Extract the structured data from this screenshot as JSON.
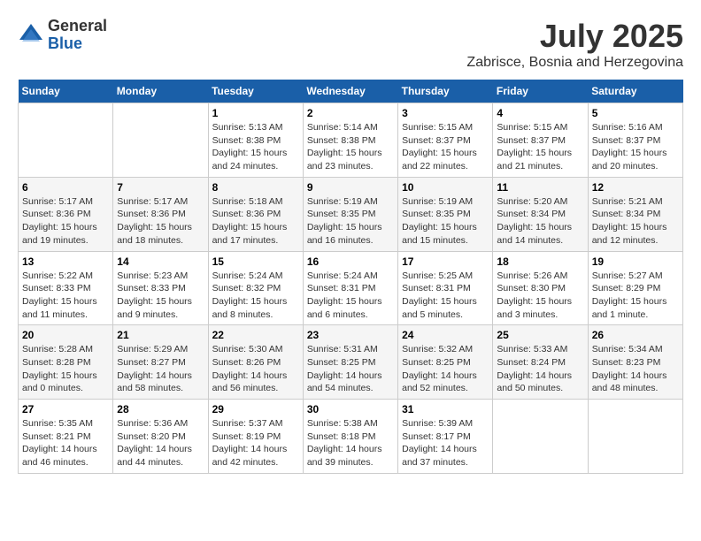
{
  "logo": {
    "general": "General",
    "blue": "Blue"
  },
  "header": {
    "month": "July 2025",
    "location": "Zabrisce, Bosnia and Herzegovina"
  },
  "weekdays": [
    "Sunday",
    "Monday",
    "Tuesday",
    "Wednesday",
    "Thursday",
    "Friday",
    "Saturday"
  ],
  "weeks": [
    [
      {
        "day": "",
        "info": ""
      },
      {
        "day": "",
        "info": ""
      },
      {
        "day": "1",
        "info": "Sunrise: 5:13 AM\nSunset: 8:38 PM\nDaylight: 15 hours\nand 24 minutes."
      },
      {
        "day": "2",
        "info": "Sunrise: 5:14 AM\nSunset: 8:38 PM\nDaylight: 15 hours\nand 23 minutes."
      },
      {
        "day": "3",
        "info": "Sunrise: 5:15 AM\nSunset: 8:37 PM\nDaylight: 15 hours\nand 22 minutes."
      },
      {
        "day": "4",
        "info": "Sunrise: 5:15 AM\nSunset: 8:37 PM\nDaylight: 15 hours\nand 21 minutes."
      },
      {
        "day": "5",
        "info": "Sunrise: 5:16 AM\nSunset: 8:37 PM\nDaylight: 15 hours\nand 20 minutes."
      }
    ],
    [
      {
        "day": "6",
        "info": "Sunrise: 5:17 AM\nSunset: 8:36 PM\nDaylight: 15 hours\nand 19 minutes."
      },
      {
        "day": "7",
        "info": "Sunrise: 5:17 AM\nSunset: 8:36 PM\nDaylight: 15 hours\nand 18 minutes."
      },
      {
        "day": "8",
        "info": "Sunrise: 5:18 AM\nSunset: 8:36 PM\nDaylight: 15 hours\nand 17 minutes."
      },
      {
        "day": "9",
        "info": "Sunrise: 5:19 AM\nSunset: 8:35 PM\nDaylight: 15 hours\nand 16 minutes."
      },
      {
        "day": "10",
        "info": "Sunrise: 5:19 AM\nSunset: 8:35 PM\nDaylight: 15 hours\nand 15 minutes."
      },
      {
        "day": "11",
        "info": "Sunrise: 5:20 AM\nSunset: 8:34 PM\nDaylight: 15 hours\nand 14 minutes."
      },
      {
        "day": "12",
        "info": "Sunrise: 5:21 AM\nSunset: 8:34 PM\nDaylight: 15 hours\nand 12 minutes."
      }
    ],
    [
      {
        "day": "13",
        "info": "Sunrise: 5:22 AM\nSunset: 8:33 PM\nDaylight: 15 hours\nand 11 minutes."
      },
      {
        "day": "14",
        "info": "Sunrise: 5:23 AM\nSunset: 8:33 PM\nDaylight: 15 hours\nand 9 minutes."
      },
      {
        "day": "15",
        "info": "Sunrise: 5:24 AM\nSunset: 8:32 PM\nDaylight: 15 hours\nand 8 minutes."
      },
      {
        "day": "16",
        "info": "Sunrise: 5:24 AM\nSunset: 8:31 PM\nDaylight: 15 hours\nand 6 minutes."
      },
      {
        "day": "17",
        "info": "Sunrise: 5:25 AM\nSunset: 8:31 PM\nDaylight: 15 hours\nand 5 minutes."
      },
      {
        "day": "18",
        "info": "Sunrise: 5:26 AM\nSunset: 8:30 PM\nDaylight: 15 hours\nand 3 minutes."
      },
      {
        "day": "19",
        "info": "Sunrise: 5:27 AM\nSunset: 8:29 PM\nDaylight: 15 hours\nand 1 minute."
      }
    ],
    [
      {
        "day": "20",
        "info": "Sunrise: 5:28 AM\nSunset: 8:28 PM\nDaylight: 15 hours\nand 0 minutes."
      },
      {
        "day": "21",
        "info": "Sunrise: 5:29 AM\nSunset: 8:27 PM\nDaylight: 14 hours\nand 58 minutes."
      },
      {
        "day": "22",
        "info": "Sunrise: 5:30 AM\nSunset: 8:26 PM\nDaylight: 14 hours\nand 56 minutes."
      },
      {
        "day": "23",
        "info": "Sunrise: 5:31 AM\nSunset: 8:25 PM\nDaylight: 14 hours\nand 54 minutes."
      },
      {
        "day": "24",
        "info": "Sunrise: 5:32 AM\nSunset: 8:25 PM\nDaylight: 14 hours\nand 52 minutes."
      },
      {
        "day": "25",
        "info": "Sunrise: 5:33 AM\nSunset: 8:24 PM\nDaylight: 14 hours\nand 50 minutes."
      },
      {
        "day": "26",
        "info": "Sunrise: 5:34 AM\nSunset: 8:23 PM\nDaylight: 14 hours\nand 48 minutes."
      }
    ],
    [
      {
        "day": "27",
        "info": "Sunrise: 5:35 AM\nSunset: 8:21 PM\nDaylight: 14 hours\nand 46 minutes."
      },
      {
        "day": "28",
        "info": "Sunrise: 5:36 AM\nSunset: 8:20 PM\nDaylight: 14 hours\nand 44 minutes."
      },
      {
        "day": "29",
        "info": "Sunrise: 5:37 AM\nSunset: 8:19 PM\nDaylight: 14 hours\nand 42 minutes."
      },
      {
        "day": "30",
        "info": "Sunrise: 5:38 AM\nSunset: 8:18 PM\nDaylight: 14 hours\nand 39 minutes."
      },
      {
        "day": "31",
        "info": "Sunrise: 5:39 AM\nSunset: 8:17 PM\nDaylight: 14 hours\nand 37 minutes."
      },
      {
        "day": "",
        "info": ""
      },
      {
        "day": "",
        "info": ""
      }
    ]
  ]
}
